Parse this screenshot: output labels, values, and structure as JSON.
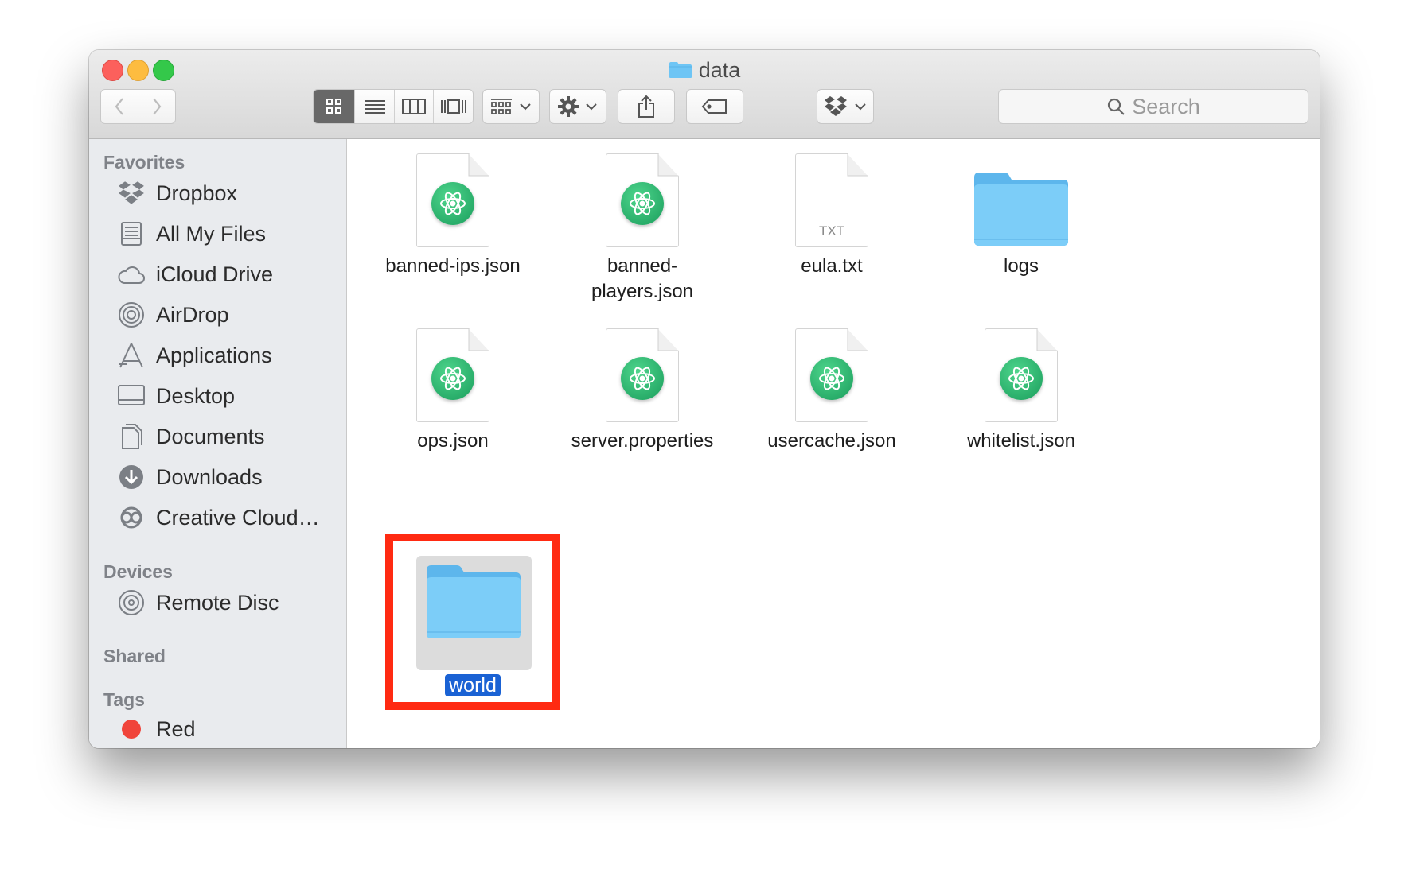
{
  "window": {
    "title": "data"
  },
  "toolbar": {
    "search_placeholder": "Search"
  },
  "sidebar": {
    "favorites_heading": "Favorites",
    "favorites": [
      {
        "label": "Dropbox",
        "icon": "dropbox-icon"
      },
      {
        "label": "All My Files",
        "icon": "all-files-icon"
      },
      {
        "label": "iCloud Drive",
        "icon": "cloud-icon"
      },
      {
        "label": "AirDrop",
        "icon": "airdrop-icon"
      },
      {
        "label": "Applications",
        "icon": "applications-icon"
      },
      {
        "label": "Desktop",
        "icon": "desktop-icon"
      },
      {
        "label": "Documents",
        "icon": "documents-icon"
      },
      {
        "label": "Downloads",
        "icon": "downloads-icon"
      },
      {
        "label": "Creative Cloud…",
        "icon": "creative-cloud-icon"
      }
    ],
    "devices_heading": "Devices",
    "devices": [
      {
        "label": "Remote Disc",
        "icon": "disc-icon"
      }
    ],
    "shared_heading": "Shared",
    "tags_heading": "Tags",
    "tags": [
      {
        "label": "Red",
        "color": "#f0443a"
      }
    ]
  },
  "files": [
    {
      "name": "banned-ips.json",
      "kind": "atom-doc"
    },
    {
      "name": "banned-players.json",
      "kind": "atom-doc"
    },
    {
      "name": "eula.txt",
      "kind": "txt-doc",
      "badge": "TXT"
    },
    {
      "name": "logs",
      "kind": "folder"
    },
    {
      "name": "ops.json",
      "kind": "atom-doc"
    },
    {
      "name": "server.properties",
      "kind": "atom-doc"
    },
    {
      "name": "usercache.json",
      "kind": "atom-doc"
    },
    {
      "name": "whitelist.json",
      "kind": "atom-doc"
    },
    {
      "name": "world",
      "kind": "folder",
      "selected": true
    }
  ],
  "colors": {
    "folder": "#6ec5f5",
    "atom": "#25b26e",
    "highlight": "#ff2a12",
    "selection": "#1a62d4"
  }
}
